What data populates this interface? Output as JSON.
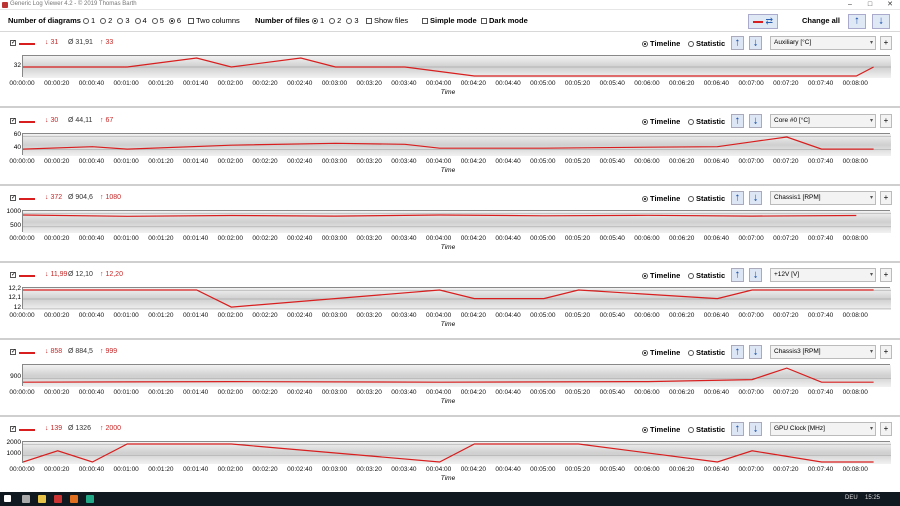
{
  "window": {
    "title": "Generic Log Viewer 4.2 - © 2019 Thomas Barth",
    "minimize": "–",
    "maximize": "□",
    "close": "✕"
  },
  "toolbar": {
    "num_diagrams_label": "Number of diagrams",
    "diagram_options": [
      "1",
      "2",
      "3",
      "4",
      "5",
      "6"
    ],
    "diagram_selected": "6",
    "two_columns_label": "Two columns",
    "num_files_label": "Number of files",
    "file_options": [
      "1",
      "2",
      "3"
    ],
    "file_selected": "1",
    "show_files_label": "Show files",
    "simple_mode_label": "Simple mode",
    "dark_mode_label": "Dark mode",
    "change_all_label": "Change all",
    "accent_color": "#d81e1e"
  },
  "time_axis": {
    "title": "Time",
    "ticks": [
      "00:00:00",
      "00:00:20",
      "00:00:40",
      "00:01:00",
      "00:01:20",
      "00:01:40",
      "00:02:00",
      "00:02:20",
      "00:02:40",
      "00:03:00",
      "00:03:20",
      "00:03:40",
      "00:04:00",
      "00:04:20",
      "00:04:40",
      "00:05:00",
      "00:05:20",
      "00:05:40",
      "00:06:00",
      "00:06:20",
      "00:06:40",
      "00:07:00",
      "00:07:20",
      "00:07:40",
      "00:08:00"
    ]
  },
  "panels": [
    {
      "min": "↓ 31",
      "avg": "Ø 31,91",
      "max": "↑ 33",
      "timeline": "Timeline",
      "statistic": "Statistic",
      "sensor": "Auxiliary [°C]",
      "add": "+",
      "yticks": [
        "32"
      ]
    },
    {
      "min": "↓ 30",
      "avg": "Ø 44,11",
      "max": "↑ 67",
      "timeline": "Timeline",
      "statistic": "Statistic",
      "sensor": "Core #0 [°C]",
      "add": "+",
      "yticks": [
        "60",
        "40"
      ]
    },
    {
      "min": "↓ 372",
      "avg": "Ø 904,6",
      "max": "↑ 1080",
      "timeline": "Timeline",
      "statistic": "Statistic",
      "sensor": "Chassis1 [RPM]",
      "add": "+",
      "yticks": [
        "1000",
        "500"
      ]
    },
    {
      "min": "↓ 11,99",
      "avg": "Ø 12,10",
      "max": "↑ 12,20",
      "timeline": "Timeline",
      "statistic": "Statistic",
      "sensor": "+12V [V]",
      "add": "+",
      "yticks": [
        "12,2",
        "12,1",
        "12"
      ]
    },
    {
      "min": "↓ 858",
      "avg": "Ø 884,5",
      "max": "↑ 999",
      "timeline": "Timeline",
      "statistic": "Statistic",
      "sensor": "Chassis3 [RPM]",
      "add": "+",
      "yticks": [
        "900"
      ]
    },
    {
      "min": "↓ 139",
      "avg": "Ø 1326",
      "max": "↑ 2000",
      "timeline": "Timeline",
      "statistic": "Statistic",
      "sensor": "GPU Clock [MHz]",
      "add": "+",
      "yticks": [
        "2000",
        "1000"
      ]
    }
  ],
  "chart_data": [
    {
      "type": "line",
      "ylabel": "Auxiliary [°C]",
      "x": [
        "00:00:00",
        "00:01:00",
        "00:01:40",
        "00:02:00",
        "00:02:40",
        "00:03:00",
        "00:03:40",
        "00:04:20",
        "00:05:00",
        "00:05:40",
        "00:06:20",
        "00:07:00",
        "00:07:40",
        "00:08:00",
        "00:08:10"
      ],
      "series": [
        {
          "values": [
            32,
            32,
            33,
            32,
            33,
            32,
            32,
            31,
            31,
            31,
            31,
            31,
            31,
            31,
            32
          ]
        }
      ],
      "ylim": [
        31,
        33
      ]
    },
    {
      "type": "line",
      "ylabel": "Core #0 [°C]",
      "x": [
        "00:00:00",
        "00:00:40",
        "00:01:00",
        "00:02:00",
        "00:03:00",
        "00:03:40",
        "00:04:00",
        "00:05:00",
        "00:06:00",
        "00:06:40",
        "00:07:00",
        "00:07:20",
        "00:07:40",
        "00:08:00",
        "00:08:10"
      ],
      "series": [
        {
          "values": [
            40,
            45,
            40,
            48,
            52,
            50,
            42,
            42,
            44,
            45,
            55,
            65,
            40,
            40,
            40
          ]
        }
      ],
      "ylim": [
        30,
        67
      ]
    },
    {
      "type": "line",
      "ylabel": "Chassis1 [RPM]",
      "x": [
        "00:00:00",
        "00:01:00",
        "00:02:00",
        "00:03:00",
        "00:04:00",
        "00:05:00",
        "00:06:00",
        "00:07:00",
        "00:08:00"
      ],
      "series": [
        {
          "values": [
            1000,
            950,
            980,
            960,
            1000,
            970,
            990,
            960,
            980
          ]
        }
      ],
      "ylim": [
        372,
        1080
      ]
    },
    {
      "type": "line",
      "ylabel": "+12V [V]",
      "x": [
        "00:00:00",
        "00:01:40",
        "00:02:00",
        "00:04:00",
        "00:04:20",
        "00:05:00",
        "00:05:20",
        "00:06:40",
        "00:07:00",
        "00:07:40",
        "00:08:10"
      ],
      "series": [
        {
          "values": [
            12.2,
            12.2,
            12.0,
            12.2,
            12.1,
            12.1,
            12.2,
            12.1,
            12.2,
            12.2,
            12.2
          ]
        }
      ],
      "ylim": [
        11.99,
        12.2
      ]
    },
    {
      "type": "line",
      "ylabel": "Chassis3 [RPM]",
      "x": [
        "00:00:00",
        "00:02:00",
        "00:04:00",
        "00:06:00",
        "00:07:00",
        "00:07:20",
        "00:07:40",
        "00:08:10"
      ],
      "series": [
        {
          "values": [
            880,
            885,
            880,
            885,
            900,
            990,
            880,
            880
          ]
        }
      ],
      "ylim": [
        858,
        999
      ]
    },
    {
      "type": "line",
      "ylabel": "GPU Clock [MHz]",
      "x": [
        "00:00:00",
        "00:00:20",
        "00:00:40",
        "00:01:00",
        "00:01:40",
        "00:02:00",
        "00:04:00",
        "00:04:20",
        "00:05:20",
        "00:06:40",
        "00:07:00",
        "00:07:40",
        "00:08:10"
      ],
      "series": [
        {
          "values": [
            139,
            1300,
            139,
            2000,
            2000,
            2000,
            139,
            2000,
            2000,
            139,
            1300,
            139,
            139
          ]
        }
      ],
      "ylim": [
        139,
        2000
      ]
    }
  ],
  "taskbar": {
    "time": "15:25",
    "lang": "DEU"
  }
}
